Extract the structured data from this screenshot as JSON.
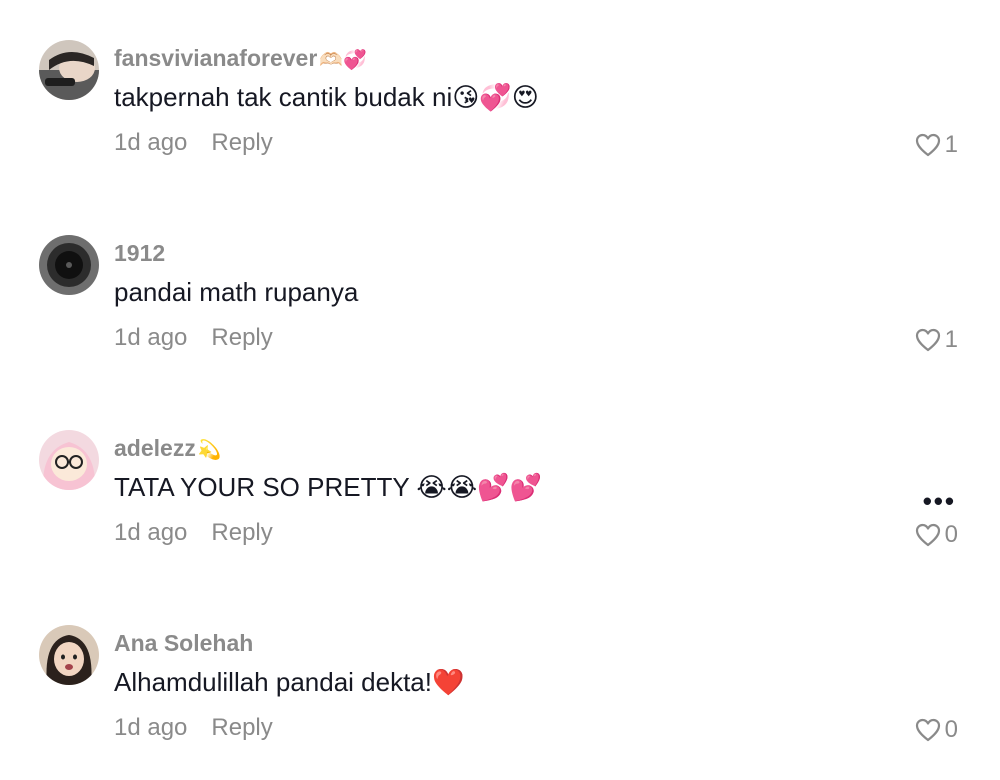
{
  "comments": [
    {
      "username": "fansvivianaforever",
      "username_emoji": "🫶🏻💞",
      "text": "takpernah tak cantik budak ni😘💞😍",
      "time": "1d ago",
      "reply": "Reply",
      "likes": "1"
    },
    {
      "username": "1912",
      "username_emoji": "",
      "text": "pandai math rupanya",
      "time": "1d ago",
      "reply": "Reply",
      "likes": "1"
    },
    {
      "username": "adelezz",
      "username_emoji": "💫",
      "text": "TATA YOUR SO PRETTY 😭😭💕💕",
      "time": "1d ago",
      "reply": "Reply",
      "likes": "0"
    },
    {
      "username": "Ana Solehah",
      "username_emoji": "",
      "text": "Alhamdulillah pandai dekta!❤️",
      "time": "1d ago",
      "reply": "Reply",
      "likes": "0"
    }
  ],
  "more_options": "•••",
  "icons": {
    "like": "heart-outline-icon",
    "more": "more-options-icon"
  }
}
